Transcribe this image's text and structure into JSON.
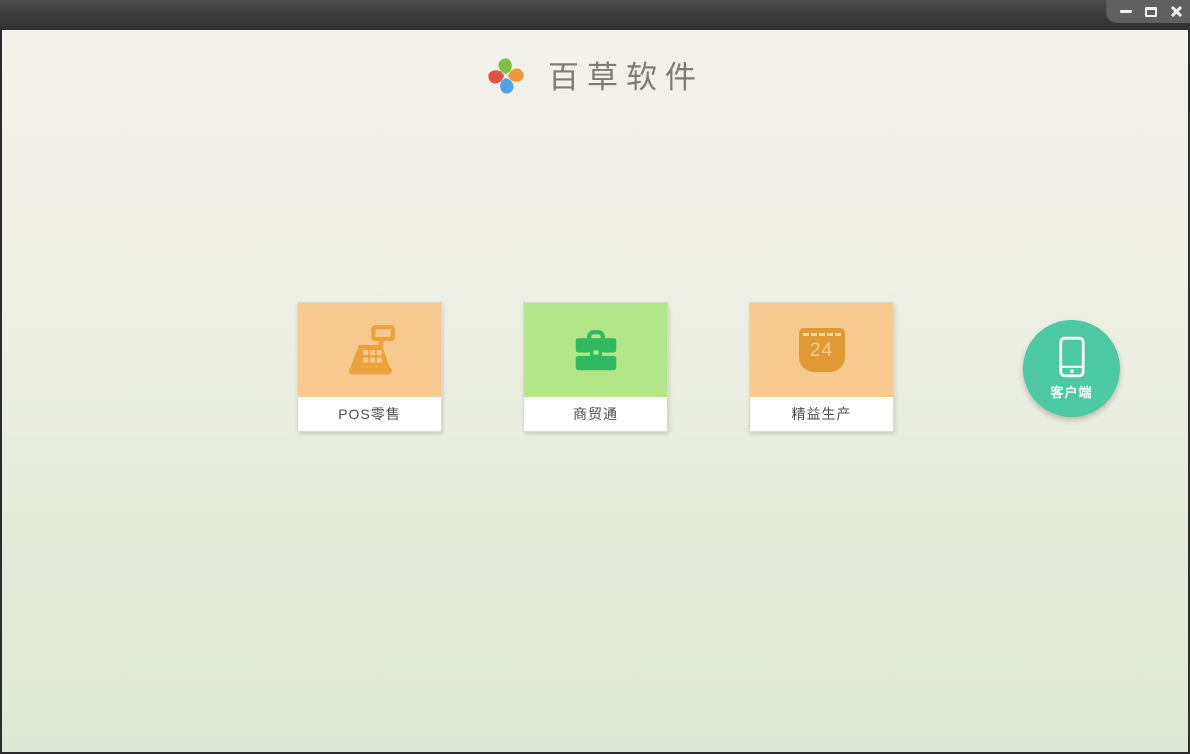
{
  "titlebar": {
    "controls": [
      {
        "name": "minimize",
        "icon": "minimize-icon"
      },
      {
        "name": "maximize",
        "icon": "maximize-icon"
      },
      {
        "name": "close",
        "icon": "close-icon"
      }
    ],
    "bar_color": "#3b3b3b",
    "controls_bg": "#606060"
  },
  "header": {
    "app_name": "百草软件",
    "logo": {
      "icon": "pinwheel-icon",
      "petal_colors": {
        "top": "#7dc142",
        "right": "#f2983a",
        "bottom": "#4ba4e8",
        "left": "#e15146"
      }
    }
  },
  "products": [
    {
      "label": "POS零售",
      "icon": "cash-register-icon",
      "tile_color": "#f8c98f",
      "icon_color": "#e8a33f"
    },
    {
      "label": "商贸通",
      "icon": "briefcase-icon",
      "tile_color": "#b3e589",
      "icon_color": "#2fba62"
    },
    {
      "label": "精益生产",
      "icon": "calendar-icon",
      "tile_color": "#f8c98f",
      "icon_color": "#e09a33",
      "calendar_day": "24"
    }
  ],
  "client_button": {
    "label": "客户端",
    "icon": "smartphone-icon",
    "color": "#4cc9a3"
  },
  "theme": {
    "background_top": "#f2f1ea",
    "background_bottom": "#dee7d6",
    "card_bg": "#ffffff",
    "label_text": "#4d4d4d"
  }
}
